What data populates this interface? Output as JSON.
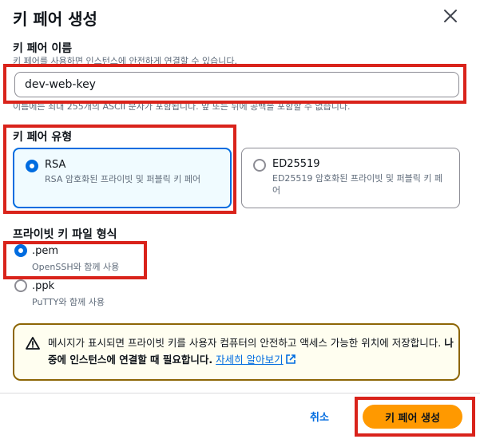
{
  "dialog": {
    "title": "키 페어 생성"
  },
  "key_name": {
    "label": "키 페어 이름",
    "description": "키 페어를 사용하면 인스턴스에 안전하게 연결할 수 있습니다.",
    "value": "dev-web-key",
    "hint": "이름에는 최대 255개의 ASCII 문자가 포함됩니다. 앞 또는 뒤에 공백을 포함할 수 없습니다."
  },
  "key_type": {
    "label": "키 페어 유형",
    "options": [
      {
        "name": "RSA",
        "description": "RSA 암호화된 프라이빗 및 퍼블릭 키 페어",
        "selected": true
      },
      {
        "name": "ED25519",
        "description": "ED25519 암호화된 프라이빗 및 퍼블릭 키 페어",
        "selected": false
      }
    ]
  },
  "file_format": {
    "label": "프라이빗 키 파일 형식",
    "options": [
      {
        "name": ".pem",
        "description": "OpenSSH와 함께 사용",
        "selected": true
      },
      {
        "name": ".ppk",
        "description": "PuTTY와 함께 사용",
        "selected": false
      }
    ]
  },
  "alert": {
    "text_part1": "메시지가 표시되면 프라이빗 키를 사용자 컴퓨터의 안전하고 액세스 가능한 위치에 저장합니다. ",
    "text_bold": "나중에 인스턴스에 연결할 때 필요합니다.",
    "link": "자세히 알아보기"
  },
  "footer": {
    "cancel": "취소",
    "create": "키 페어 생성"
  },
  "colors": {
    "accent": "#006ce0",
    "primary_button": "#ff9900",
    "warning_border": "#8d6605",
    "highlight": "#d9231b"
  }
}
